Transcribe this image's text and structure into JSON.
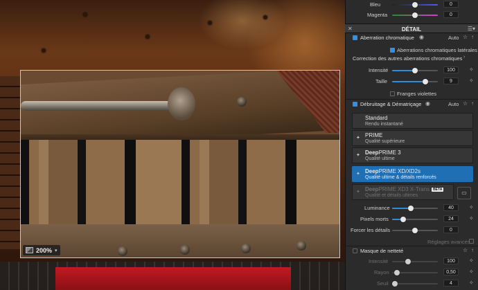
{
  "viewer": {
    "zoom": "200%"
  },
  "top_sliders": [
    {
      "label": "Bleu",
      "value": "0",
      "position": 0.5,
      "fill": "#4060ff"
    },
    {
      "label": "Magenta",
      "value": "0",
      "position": 0.5,
      "fill": "#d040d0"
    }
  ],
  "panel": {
    "title": "DÉTAIL",
    "chromatic": {
      "title": "Aberration chromatique",
      "auto": "Auto",
      "lateral_label": "Aberrations chromatiques latérales",
      "other_label": "Correction des autres aberrations chromatiques",
      "intensity": {
        "label": "Intensité",
        "value": "100",
        "position": 0.5
      },
      "size": {
        "label": "Taille",
        "value": "9",
        "position": 0.72
      },
      "purple_label": "Franges violettes"
    },
    "denoise": {
      "title": "Débruitage & Dématriçage",
      "auto": "Auto",
      "options": [
        {
          "name": "Standard",
          "sub": "Rendu instantané",
          "icon": ""
        },
        {
          "name": "PRIME",
          "sub": "Qualité supérieure",
          "icon": "✦"
        },
        {
          "name_bold": "Deep",
          "name": "PRIME 3",
          "sub": "Qualité ultime",
          "icon": "✦"
        },
        {
          "name_bold": "Deep",
          "name": "PRIME XD/XD2s",
          "sub": "Qualité ultime & détails renforcés",
          "icon": "✦"
        },
        {
          "name_bold": "Deep",
          "name": "PRIME XD3 X-Trans",
          "badge": "BETA",
          "sub": "Qualité et détails ultimes",
          "icon": "✦"
        }
      ],
      "luminance": {
        "label": "Luminance",
        "value": "40",
        "position": 0.35
      },
      "dead_pixels": {
        "label": "Pixels morts",
        "value": "24",
        "position": 0.18
      },
      "force_details": {
        "label": "Forcer les détails",
        "value": "0",
        "position": 0.5
      },
      "advanced": "Réglages avancés"
    },
    "sharpness": {
      "title": "Masque de netteté",
      "intensity": {
        "label": "Intensité",
        "value": "100",
        "position": 0.25
      },
      "radius": {
        "label": "Rayon",
        "value": "0,50",
        "position": 0.05
      },
      "threshold": {
        "label": "Seuil",
        "value": "4",
        "position": 0.02
      }
    }
  },
  "colors": {
    "accent": "#2e8ed8",
    "selected": "#1f6fb5",
    "panel_bg": "#2b2b2b"
  }
}
